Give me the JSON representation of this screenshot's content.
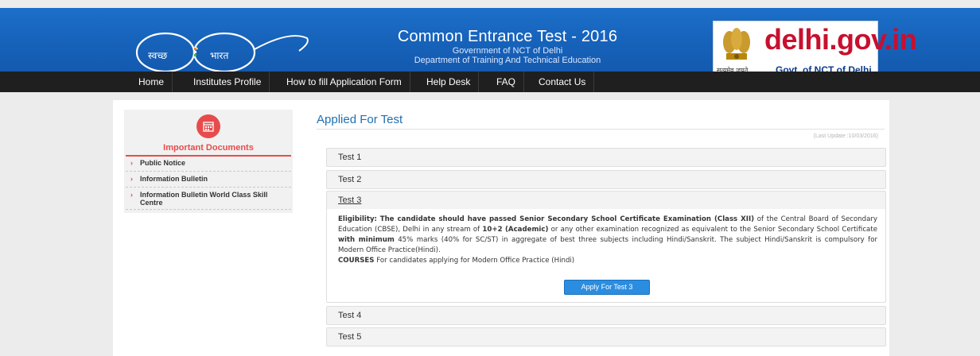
{
  "banner": {
    "title": "Common Entrance Test - 2016",
    "subtitle1": "Government of NCT of Delhi",
    "subtitle2": "Department of Training And Technical Education",
    "swachh_text1": "स्वच्छ",
    "swachh_text2": "भारत",
    "delhi_name": "delhi.gov.in",
    "delhi_moto": "सत्यमेव जयते",
    "delhi_govt": "Govt. of NCT of Delhi"
  },
  "nav": {
    "items": [
      "Home",
      "Institutes Profile",
      "How to fill Application Form",
      "Help Desk",
      "FAQ",
      "Contact Us"
    ]
  },
  "sidebar": {
    "heading": "Important Documents",
    "items": [
      "Public Notice",
      "Information Bulletin",
      "Information Bulletin World Class Skill Centre"
    ]
  },
  "main": {
    "title": "Applied For Test",
    "last_update": "(Last Update :10/03/2016)",
    "tests": [
      "Test 1",
      "Test 2",
      "Test 3",
      "Test 4",
      "Test 5"
    ],
    "open_test": {
      "eligibility_label": "Eligibility:",
      "eligibility_bold": "The candidate should have passed Senior Secondary School Certificate Examination (Class XII)",
      "text1": "of the Central Board of Secondary Education (CBSE), Delhi in any stream of",
      "stream_bold": "10+2 (Academic)",
      "text2": "or any other examination recognized as equivalent to the Senior Secondary School Certificate",
      "min_bold": "with minimum",
      "text3": "45% marks (40% for SC/ST) in aggregate of best three subjects including Hindi/Sanskrit. The subject Hindi/Sanskrit is compulsory for Modern Office Practice(Hindi).",
      "courses_bold": "COURSES",
      "courses_text": "For candidates applying for Modern Office Practice (Hindi)",
      "apply_label": "Apply For Test 3"
    }
  },
  "colors": {
    "banner_blue": "#1763bb",
    "nav_black": "#1f1f1f",
    "accent_red": "#e74c4c",
    "title_blue": "#1f6fb2",
    "button_blue": "#2b8de0"
  }
}
